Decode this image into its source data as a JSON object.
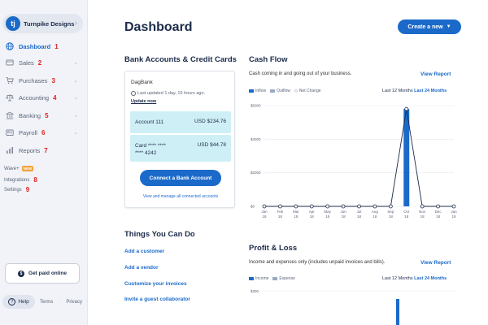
{
  "sidebar": {
    "brand": {
      "logo": "tj",
      "name": "Turnpike Designs"
    },
    "items": [
      {
        "label": "Dashboard",
        "icon": "globe-icon",
        "marker": "1"
      },
      {
        "label": "Sales",
        "icon": "sales-icon",
        "marker": "2"
      },
      {
        "label": "Purchases",
        "icon": "cart-icon",
        "marker": "3"
      },
      {
        "label": "Accounting",
        "icon": "scale-icon",
        "marker": "4"
      },
      {
        "label": "Banking",
        "icon": "bank-icon",
        "marker": "5"
      },
      {
        "label": "Payroll",
        "icon": "payroll-icon",
        "marker": "6"
      },
      {
        "label": "Reports",
        "icon": "bar-chart-icon",
        "marker": "7"
      }
    ],
    "wave_link": "Wave+",
    "new_badge": "NEW",
    "integrations": "Integrations",
    "integrations_marker": "8",
    "settings": "Settings",
    "settings_marker": "9",
    "get_paid": "Get paid online",
    "help": "Help",
    "terms": "Terms",
    "privacy": "Privacy"
  },
  "header": {
    "title": "Dashboard",
    "create_button": "Create a new"
  },
  "bank": {
    "title": "Bank Accounts & Credit Cards",
    "bank_name": "DagBank",
    "updated": "Last updated 1 day, 15 hours ago.",
    "update_now": "Update now",
    "accounts": [
      {
        "name": "Account 111",
        "amount": "USD $234.76"
      },
      {
        "name_line1": "Card **** ****",
        "name_line2": "**** 4242",
        "amount": "USD $44.78"
      }
    ],
    "connect_button": "Connect a Bank Account",
    "view_manage": "View and manage all connected accounts"
  },
  "things": {
    "title": "Things You Can Do",
    "items": [
      "Add a customer",
      "Add a vendor",
      "Customize your invoices",
      "Invite a guest collaborator"
    ]
  },
  "cashflow": {
    "title": "Cash Flow",
    "description": "Cash coming in and going out of your business.",
    "view_report": "View Report",
    "legend": [
      "Inflow",
      "Outflow",
      "Net Change"
    ],
    "range_12": "Last 12 Months",
    "range_24": "Last 24 Months"
  },
  "profit": {
    "title": "Profit & Loss",
    "description": "Income and expenses only (includes unpaid invoices and bills).",
    "view_report": "View Report",
    "legend": [
      "Income",
      "Expense"
    ],
    "range_12": "Last 12 Months",
    "range_24": "Last 24 Months",
    "y_top": "$300"
  },
  "colors": {
    "accent": "#1b6ac9",
    "inflow": "#1b6ac9",
    "outflow": "#9aa9c3",
    "marker": "#e02020"
  },
  "chart_data": [
    {
      "type": "bar",
      "title": "Cash Flow",
      "categories": [
        "Jan 18",
        "Feb 18",
        "Mar 18",
        "Apr 18",
        "May 18",
        "Jun 18",
        "Jul 18",
        "Aug 18",
        "Sep 18",
        "Oct 18",
        "Nov 18",
        "Dec 18",
        "Jan 19"
      ],
      "series": [
        {
          "name": "Inflow",
          "values": [
            0,
            0,
            0,
            0,
            0,
            0,
            0,
            0,
            0,
            5800,
            0,
            0,
            0
          ]
        },
        {
          "name": "Outflow",
          "values": [
            0,
            0,
            0,
            0,
            0,
            0,
            0,
            0,
            0,
            0,
            0,
            0,
            0
          ]
        },
        {
          "name": "Net Change",
          "values": [
            0,
            0,
            0,
            0,
            0,
            0,
            0,
            0,
            0,
            5800,
            0,
            0,
            0
          ]
        }
      ],
      "yticks": [
        "$0",
        "$2000",
        "$4000",
        "$6000"
      ],
      "ylim": [
        0,
        6000
      ],
      "grid": true,
      "legend": "top-left"
    },
    {
      "type": "bar",
      "title": "Profit & Loss",
      "series": [
        {
          "name": "Income",
          "values": []
        },
        {
          "name": "Expense",
          "values": []
        }
      ],
      "yticks": [
        "$300"
      ],
      "legend": "top-left"
    }
  ]
}
